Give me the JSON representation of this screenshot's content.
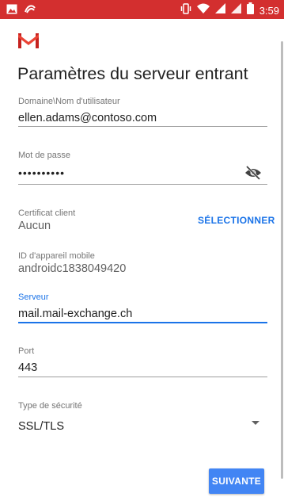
{
  "status_bar": {
    "time": "3:59",
    "left_icons": [
      "image-icon",
      "swirl-notification-icon"
    ],
    "right_icons": [
      "vibrate-icon",
      "wifi-icon",
      "signal-icon",
      "signal-icon-2",
      "battery-icon"
    ]
  },
  "header": {
    "logo": "gmail-m-icon",
    "title": "Paramètres du serveur entrant"
  },
  "form": {
    "username": {
      "label": "Domaine\\Nom d'utilisateur",
      "value": "ellen.adams@contoso.com"
    },
    "password": {
      "label": "Mot de passe",
      "value": "••••••••••",
      "toggle_icon": "visibility-off-icon"
    },
    "client_certificate": {
      "label": "Certificat client",
      "value": "Aucun",
      "action": "SÉLECTIONNER"
    },
    "device_id": {
      "label": "ID d'appareil mobile",
      "value": "androidc1838049420"
    },
    "server": {
      "label": "Serveur",
      "value": "mail.mail-exchange.ch"
    },
    "port": {
      "label": "Port",
      "value": "443"
    },
    "security_type": {
      "label": "Type de sécurité",
      "value": "SSL/TLS"
    }
  },
  "actions": {
    "next": "SUIVANTE"
  },
  "colors": {
    "status_bar": "#d32f2f",
    "accent": "#1a73e8",
    "button": "#4285f4"
  }
}
